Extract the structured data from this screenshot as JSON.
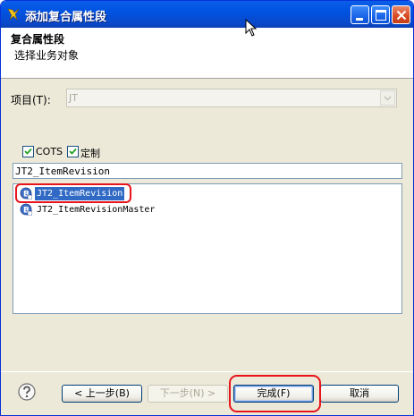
{
  "window": {
    "title": "添加复合属性段",
    "controls": {
      "minimize_icon": "minimize-icon",
      "maximize_icon": "maximize-icon",
      "close_icon": "close-icon"
    }
  },
  "header": {
    "title": "复合属性段",
    "description": "选择业务对象"
  },
  "project": {
    "label": "项目(T):",
    "selected_value": "JT",
    "disabled": true
  },
  "filters": {
    "cots_label": "COTS",
    "cots_checked": true,
    "custom_label": "定制",
    "custom_checked": true
  },
  "search": {
    "value": "JT2_ItemRevision"
  },
  "list": {
    "items": [
      {
        "label": "JT2_ItemRevision",
        "selected": true,
        "icon": "business-object-icon"
      },
      {
        "label": "JT2_ItemRevisionMaster",
        "selected": false,
        "icon": "business-object-icon"
      }
    ]
  },
  "buttons": {
    "back": "< 上一步(B)",
    "next": "下一步(N) >",
    "finish": "完成(F)",
    "cancel": "取消"
  },
  "colors": {
    "titlebar": "#0053E1",
    "selection": "#316AC5",
    "annotation": "#E8141C",
    "dialog_bg": "#ECE9D8"
  }
}
